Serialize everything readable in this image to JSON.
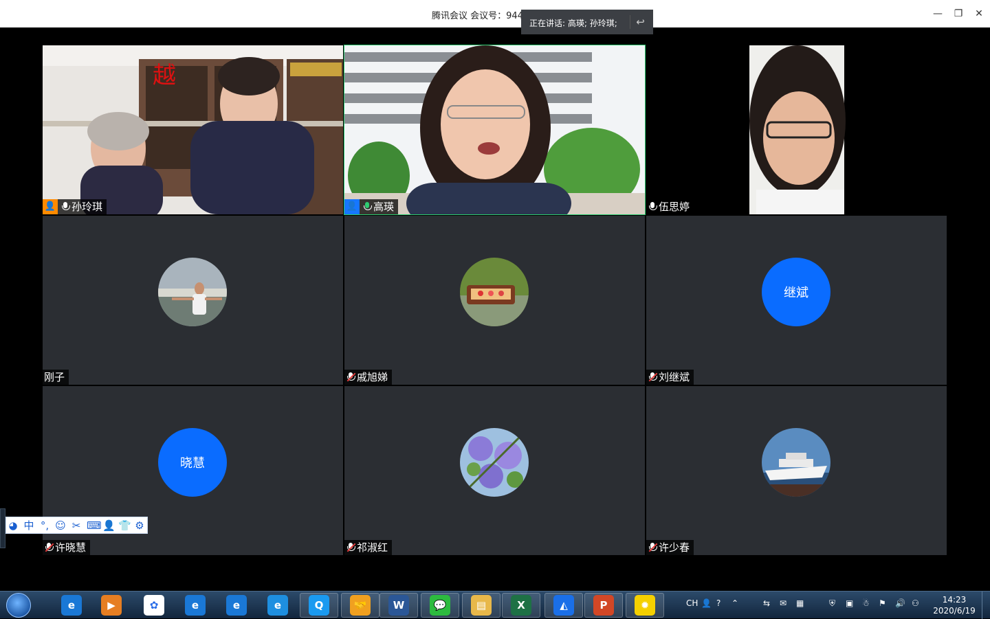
{
  "window": {
    "title": "腾讯会议 会议号：944",
    "speaking_label": "正在讲话: 高瑛; 孙玲琪;",
    "controls": {
      "minimize": "—",
      "restore": "❐",
      "close": "✕"
    }
  },
  "participants": [
    {
      "name": "孙玲琪",
      "mode": "video",
      "role": "host",
      "mic": "on",
      "active": false
    },
    {
      "name": "高瑛",
      "mode": "video",
      "role": "cohost",
      "mic": "on-green",
      "active": true
    },
    {
      "name": "伍思婷",
      "mode": "video",
      "role": "none",
      "mic": "on",
      "active": false
    },
    {
      "name": "刚子",
      "mode": "avatar-photo",
      "role": "none",
      "mic": "none",
      "active": false
    },
    {
      "name": "戚旭娣",
      "mode": "avatar-photo",
      "role": "none",
      "mic": "muted",
      "active": false
    },
    {
      "name": "刘继斌",
      "mode": "avatar-text",
      "avatar_text": "继斌",
      "role": "none",
      "mic": "muted",
      "active": false
    },
    {
      "name": "许晓慧",
      "mode": "avatar-text",
      "avatar_text": "晓慧",
      "role": "none",
      "mic": "muted",
      "active": false
    },
    {
      "name": "祁淑红",
      "mode": "avatar-photo",
      "role": "none",
      "mic": "muted",
      "active": false
    },
    {
      "name": "许少春",
      "mode": "avatar-photo",
      "role": "none",
      "mic": "muted",
      "active": false
    }
  ],
  "ime_toolbar": {
    "mode_label": "中",
    "icons": [
      "ime-logo-icon",
      "mode-icon",
      "punctuation-icon",
      "emoji-icon",
      "scissors-icon",
      "keyboard-icon",
      "user-icon",
      "skin-icon",
      "settings-icon"
    ]
  },
  "taskbar": {
    "apps": [
      {
        "name": "ie-icon",
        "color": "#1a78d6",
        "glyph": "e",
        "open": false
      },
      {
        "name": "media-player-icon",
        "color": "#e67e22",
        "glyph": "▶",
        "open": false
      },
      {
        "name": "baidu-netdisk-icon",
        "color": "#ffffff",
        "glyph": "✿",
        "open": false
      },
      {
        "name": "ie-icon-2",
        "color": "#1a78d6",
        "glyph": "e",
        "open": false
      },
      {
        "name": "ie-icon-3",
        "color": "#1a78d6",
        "glyph": "e",
        "open": false
      },
      {
        "name": "edge-icon",
        "color": "#1e8fe0",
        "glyph": "e",
        "open": false
      },
      {
        "name": "qq-browser-icon",
        "color": "#1a9af0",
        "glyph": "Q",
        "open": true
      },
      {
        "name": "meeting-handshake-icon",
        "color": "#f0a020",
        "glyph": "🤝",
        "open": true
      },
      {
        "name": "word-icon",
        "color": "#2b5797",
        "glyph": "W",
        "open": true
      },
      {
        "name": "wechat-icon",
        "color": "#2dbb3f",
        "glyph": "💬",
        "open": true
      },
      {
        "name": "file-explorer-icon",
        "color": "#e8b84a",
        "glyph": "▤",
        "open": true
      },
      {
        "name": "excel-icon",
        "color": "#1e7145",
        "glyph": "X",
        "open": true
      },
      {
        "name": "tencent-meeting-icon",
        "color": "#1a6fe8",
        "glyph": "◭",
        "open": true
      },
      {
        "name": "powerpoint-icon",
        "color": "#d24726",
        "glyph": "P",
        "open": true
      },
      {
        "name": "photo-app-icon",
        "color": "#f5d000",
        "glyph": "✹",
        "open": true
      }
    ],
    "tray_lang": "CH",
    "clock_time": "14:23",
    "clock_date": "2020/6/19"
  }
}
